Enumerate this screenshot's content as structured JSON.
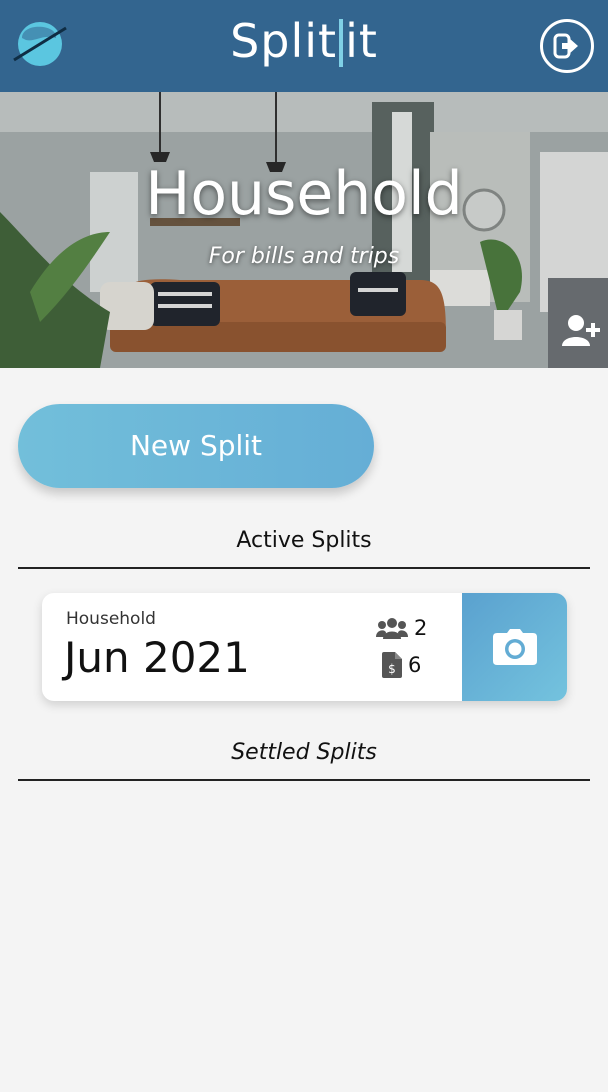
{
  "header": {
    "brand_left": "Split",
    "brand_right": "it",
    "logo_icon": "splitit-logo-icon",
    "logout_icon": "logout-icon"
  },
  "hero": {
    "title": "Household",
    "subtitle": "For bills and trips",
    "add_member_icon": "add-user-icon"
  },
  "actions": {
    "new_split_label": "New Split"
  },
  "sections": {
    "active_title": "Active Splits",
    "settled_title": "Settled Splits"
  },
  "active_splits": [
    {
      "group": "Household",
      "period": "Jun 2021",
      "members_count": "2",
      "bills_count": "6",
      "members_icon": "users-icon",
      "bills_icon": "receipt-icon",
      "action_icon": "camera-icon"
    }
  ],
  "colors": {
    "header_bg": "#33658f",
    "accent": "#6bb8d9",
    "page_bg": "#f4f4f4"
  }
}
